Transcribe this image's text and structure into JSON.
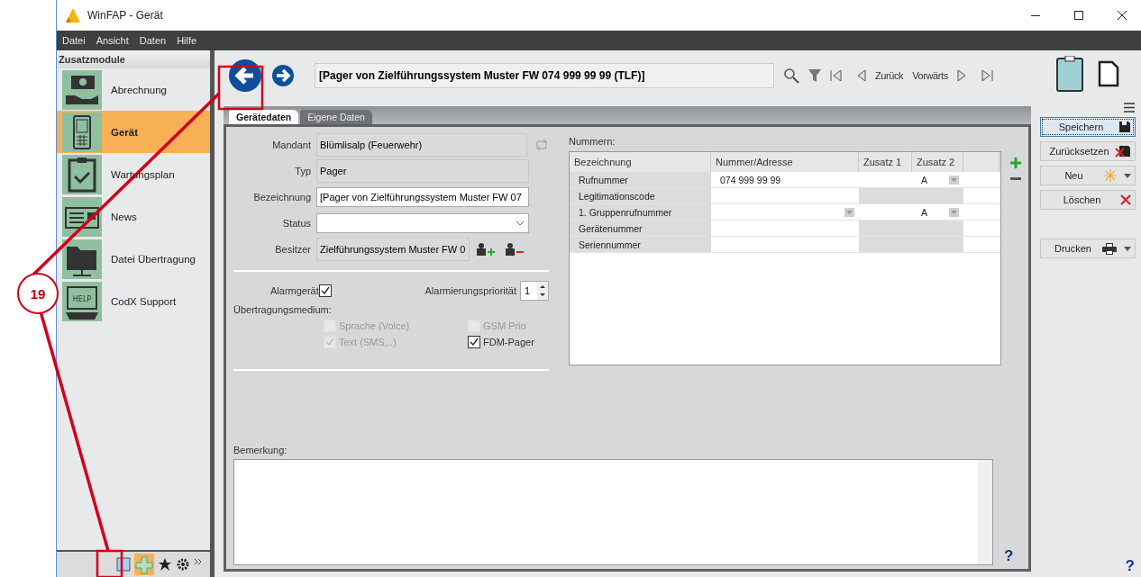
{
  "window": {
    "title": "WinFAP - Gerät"
  },
  "menu": [
    "Datei",
    "Ansicht",
    "Daten",
    "Hilfe"
  ],
  "sidebar": {
    "title": "Zusatzmodule",
    "items": [
      {
        "label": "Abrechnung",
        "selected": false
      },
      {
        "label": "Gerät",
        "selected": true
      },
      {
        "label": "Wartungsplan",
        "selected": false
      },
      {
        "label": "News",
        "selected": false
      },
      {
        "label": "Datei Übertragung",
        "selected": false
      },
      {
        "label": "CodX Support",
        "selected": false
      }
    ],
    "footer_help_label": "HELP"
  },
  "toolbar": {
    "record_title": "[Pager von Zielführungssystem Muster FW 074 999 99 99 (TLF)]",
    "back_label": "Zurück",
    "forward_label": "Vorwärts"
  },
  "tabs": [
    {
      "label": "Gerätedaten",
      "selected": true
    },
    {
      "label": "Eigene Daten",
      "selected": false
    }
  ],
  "form": {
    "fields": [
      {
        "label": "Mandant",
        "kind": "text",
        "value": "Blümlisalp (Feuerwehr)",
        "readonly": true
      },
      {
        "label": "Typ",
        "kind": "text",
        "value": "Pager",
        "readonly": true
      },
      {
        "label": "Bezeichnung",
        "kind": "text",
        "value": "[Pager von Zielführungssystem Muster FW 07",
        "readonly": false
      },
      {
        "label": "Status",
        "kind": "select",
        "readonly": false
      },
      {
        "label": "Besitzer",
        "kind": "owner",
        "value": "Zielführungssystem Muster FW 0",
        "readonly": true
      }
    ],
    "alarm_device": {
      "label": "Alarmgerät",
      "checked": true
    },
    "priority": {
      "label": "Alarmierungspriorität",
      "value": "1"
    },
    "medium_label": "Übertragungsmedium:",
    "media": [
      {
        "label": "Sprache (Voice)",
        "checked": false,
        "disabled": true
      },
      {
        "label": "GSM Prio",
        "checked": false,
        "disabled": true
      },
      {
        "label": "Text (SMS,..)",
        "checked": true,
        "disabled": true
      },
      {
        "label": "FDM-Pager",
        "checked": true,
        "disabled": false
      }
    ]
  },
  "numbers": {
    "title": "Nummern:",
    "columns": [
      "Bezeichnung",
      "Nummer/Adresse",
      "Zusatz 1",
      "Zusatz 2"
    ],
    "rows": [
      {
        "label": "Rufnummer",
        "number": "074 999 99 99",
        "extra2": "A",
        "extras": true,
        "number_dropdown": false
      },
      {
        "label": "Legitimationscode",
        "extras": false,
        "number_dropdown": false
      },
      {
        "label": "1. Gruppenrufnummer",
        "extra2": "A",
        "extras": true,
        "number_dropdown": true
      },
      {
        "label": "Gerätenummer",
        "extras": false,
        "number_dropdown": false
      },
      {
        "label": "Seriennummer",
        "extras": false,
        "number_dropdown": false
      }
    ]
  },
  "remark": {
    "label": "Bemerkung:"
  },
  "help_marks": [
    "?",
    "?"
  ],
  "actions": [
    {
      "label": "Speichern",
      "kind": "save",
      "focused": true
    },
    {
      "label": "Zurücksetzen",
      "kind": "reset",
      "focused": false
    },
    {
      "label": "Neu",
      "kind": "new",
      "focused": false
    },
    {
      "label": "Löschen",
      "kind": "delete",
      "focused": false
    },
    {
      "label": "Drucken",
      "kind": "print",
      "focused": false
    }
  ],
  "callout": {
    "number": "19"
  }
}
